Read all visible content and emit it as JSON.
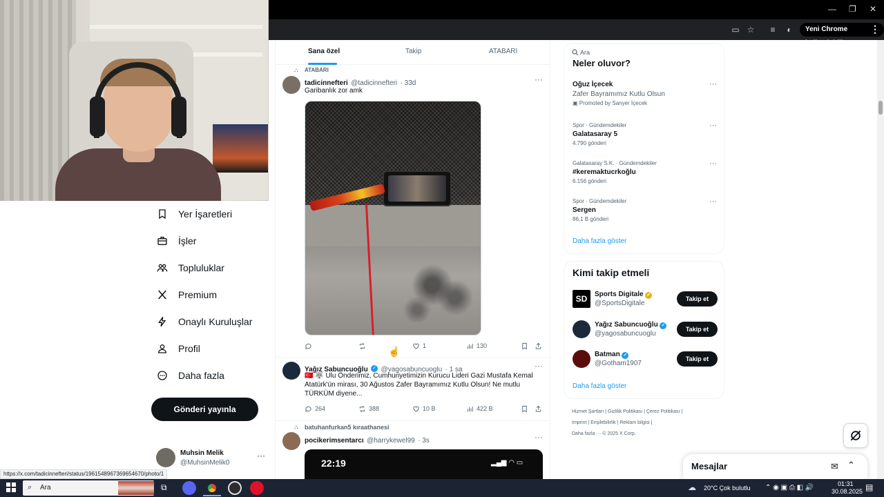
{
  "browser": {
    "profile_label": "Yeni Chrome kullanılabilir",
    "status_url": "https://x.com/tadicinnefteri/status/1961548967369654670/photo/1"
  },
  "nav": {
    "items": [
      {
        "label": "Yer İşaretleri",
        "icon": "bookmark-icon"
      },
      {
        "label": "İşler",
        "icon": "briefcase-icon"
      },
      {
        "label": "Topluluklar",
        "icon": "people-icon"
      },
      {
        "label": "Premium",
        "icon": "x-logo-icon"
      },
      {
        "label": "Onaylı Kuruluşlar",
        "icon": "lightning-icon"
      },
      {
        "label": "Profil",
        "icon": "person-icon"
      },
      {
        "label": "Daha fazla",
        "icon": "more-circle-icon"
      }
    ],
    "post_button": "Gönderi yayınla",
    "account": {
      "name": "Muhsin Melik",
      "handle": "@MuhsinMelik0"
    }
  },
  "feed": {
    "tabs": [
      "Sana özel",
      "Takip",
      "ATABARI"
    ],
    "tweet1": {
      "community": "ATABARI",
      "name": "tadicinnefteri",
      "handle": "@tadicinnefteri",
      "time": "· 33d",
      "text": "Garibanlık zor amk",
      "stats": {
        "replies": "",
        "reposts": "",
        "likes": "1",
        "views": "130"
      }
    },
    "tweet2": {
      "name": "Yağız Sabuncuoğlu",
      "handle": "@yagosabuncuoglu",
      "time": "· 1 sa",
      "text_line1": "🇹🇷 🐺 Ulu Önderimiz, Cumhuriyetimizin Kurucu Lideri Gazi Mustafa Kemal",
      "text_line2": "Atatürk'ün mirası, 30 Ağustos Zafer Bayramımız Kutlu Olsun! Ne mutlu",
      "text_line3": "TÜRKÜM diyene...",
      "stats": {
        "replies": "264",
        "reposts": "388",
        "likes": "10 B",
        "views": "422 B"
      }
    },
    "tweet3": {
      "context": "batuhanfurkan5 kıraathanesi",
      "name": "pocikerimsentarcı",
      "handle": "@harrykewel99",
      "time": "· 3s",
      "phone_time": "22:19"
    }
  },
  "sidebar": {
    "search_placeholder": "Ara",
    "trends_heading": "Neler oluyor?",
    "trends": [
      {
        "meta": "",
        "title": "Oğuz İçecek",
        "sub": "Zafer Bayramımız Kutlu Olsun",
        "extra": "Promoted by Sanyer İçecek"
      },
      {
        "meta": "Spor · Gündemdekiler",
        "title": "Galatasaray 5",
        "sub": "",
        "extra": "4.790 gönderi"
      },
      {
        "meta": "Galatasaray S.K. · Gündemdekiler",
        "title": "#keremaktucrkoğlu",
        "sub": "",
        "extra": "6.156 gönderi"
      },
      {
        "meta": "Spor · Gündemdekiler",
        "title": "Sergen",
        "sub": "",
        "extra": "86,1 B gönderi"
      }
    ],
    "show_more": "Daha fazla göster",
    "who_to_follow": {
      "title": "Kimi takip etmeli",
      "accounts": [
        {
          "name": "Sports Digitale",
          "handle": "@SportsDigitale",
          "button": "Takip et"
        },
        {
          "name": "Yağız Sabuncuoğlu",
          "handle": "@yagosabuncuoglu",
          "button": "Takip et"
        },
        {
          "name": "Batman",
          "handle": "@Gotham1907",
          "button": "Takip et"
        }
      ],
      "show_more": "Daha fazla göster"
    },
    "footer_line1": "Hizmet Şartları  |  Gizlilik Politikası  |  Çerez Politikası  |",
    "footer_line2": "Imprint  |  Erişilebilirlik  |  Reklam bilgisi  |",
    "footer_line3": "Daha fazla ···    © 2025 X Corp.",
    "messages_title": "Mesajlar"
  },
  "taskbar": {
    "search_text": "Ara",
    "weather": "20°C  Çok bulutlu",
    "time": "01:31",
    "date": "30.08.2025"
  },
  "colors": {
    "accent": "#1d9bf0",
    "text": "#0f1419",
    "muted": "#536471",
    "verified": "#1d9bf0",
    "gold": "#e2b719"
  }
}
